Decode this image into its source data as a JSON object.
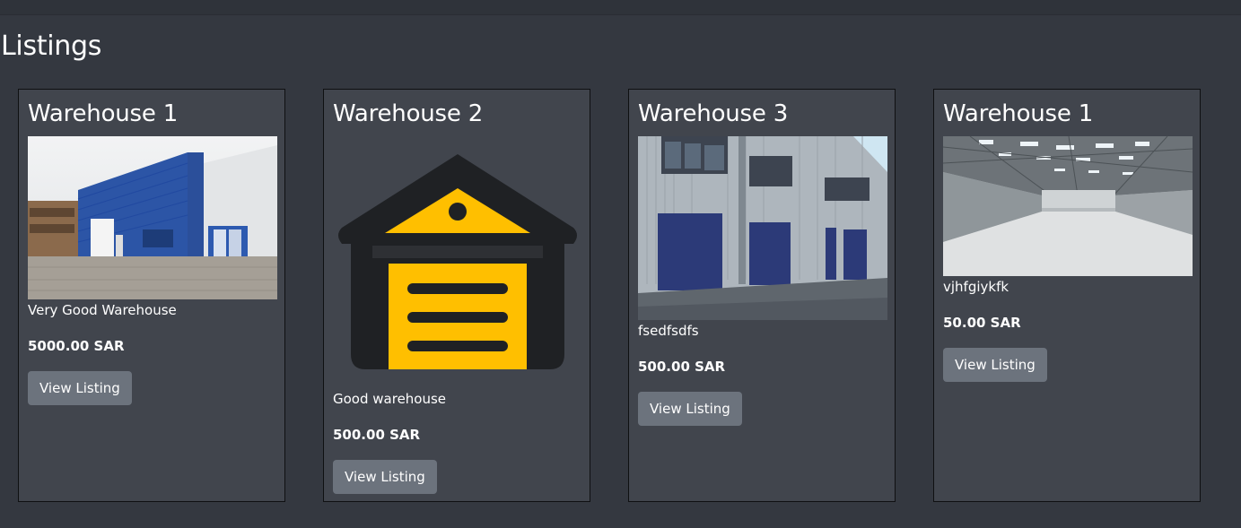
{
  "page": {
    "title": "Listings"
  },
  "listings": [
    {
      "title": "Warehouse 1",
      "image": "blue-warehouse-photo",
      "description": "Very Good Warehouse",
      "price": "5000.00 SAR",
      "button_label": "View Listing"
    },
    {
      "title": "Warehouse 2",
      "image": "garage-door-icon",
      "description": "Good warehouse",
      "price": "500.00 SAR",
      "button_label": "View Listing"
    },
    {
      "title": "Warehouse 3",
      "image": "industrial-units-photo",
      "description": "fsedfsdfs",
      "price": "500.00 SAR",
      "button_label": "View Listing"
    },
    {
      "title": "Warehouse 1",
      "image": "warehouse-interior-photo",
      "description": "vjhfgiykfk",
      "price": "50.00 SAR",
      "button_label": "View Listing"
    }
  ],
  "colors": {
    "background": "#343840",
    "card": "#41454d",
    "button": "#6c737d",
    "accent_yellow": "#ffbf00"
  }
}
